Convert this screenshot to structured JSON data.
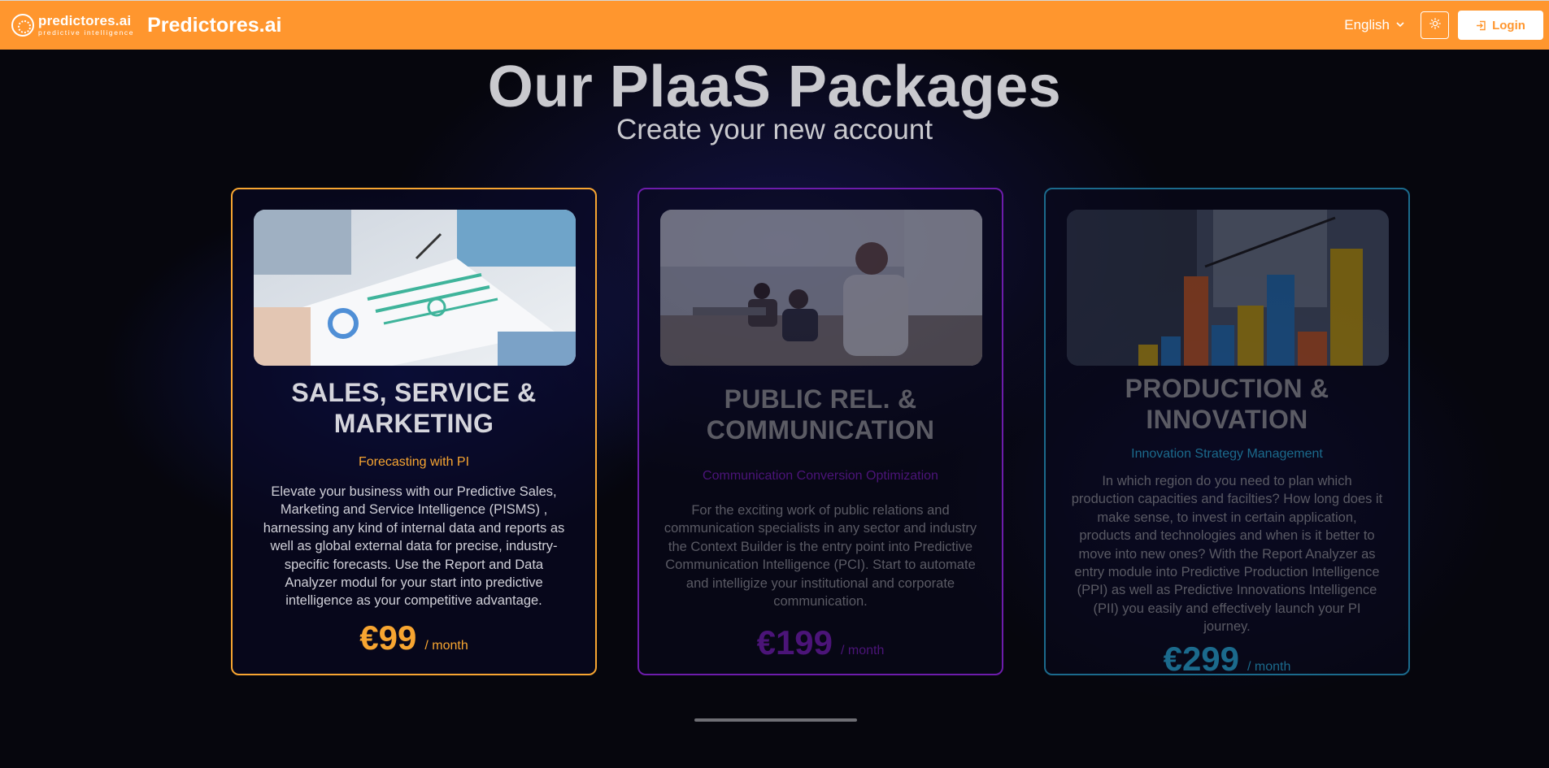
{
  "header": {
    "logo_word": "predictores.ai",
    "logo_sub": "predictive intelligence",
    "brand": "Predictores.ai",
    "language": "English",
    "login_label": "Login",
    "accent": "#ff962e"
  },
  "hero": {
    "title": "Our PlaaS Packages",
    "subtitle": "Create your new account"
  },
  "packages": [
    {
      "title": "SALES, SERVICE & MARKETING",
      "subtitle": "Forecasting with PI",
      "description": "Elevate your business with our Predictive Sales, Marketing and Service Intelligence (PISMS) , harnessing any kind of internal data and reports as well as global external data for precise, industry-specific forecasts. Use the Report and Data Analyzer modul for your start into predictive intelligence as your competitive advantage.",
      "price": "€99",
      "period": "/ month",
      "color": "#f7a531",
      "state": "active"
    },
    {
      "title": "PUBLIC REL. & COMMUNICATION",
      "subtitle": "Communication Conversion Optimization",
      "description": "For the exciting work of public relations and communication specialists in any sector and industry the Context Builder is the entry point into Predictive Communication Intelligence (PCI). Start to automate and intelligize your institutional and corporate communication.",
      "price": "€199",
      "period": "/ month",
      "color": "#6d1cab",
      "state": "inactive"
    },
    {
      "title": "PRODUCTION & INNOVATION",
      "subtitle": "Innovation Strategy Management",
      "description": "In which region do you need to plan which production capacities and facilties? How long does it make sense, to invest in certain application, products and technologies and when is it better to move into new ones? With the Report Analyzer as entry module into Predictive Production Intelligence (PPI) as well as Predictive Innovations Intelligence (PII) you easily and effectively launch your PI journey.",
      "price": "€299",
      "period": "/ month",
      "color": "#1b6a8c",
      "state": "inactive"
    }
  ]
}
